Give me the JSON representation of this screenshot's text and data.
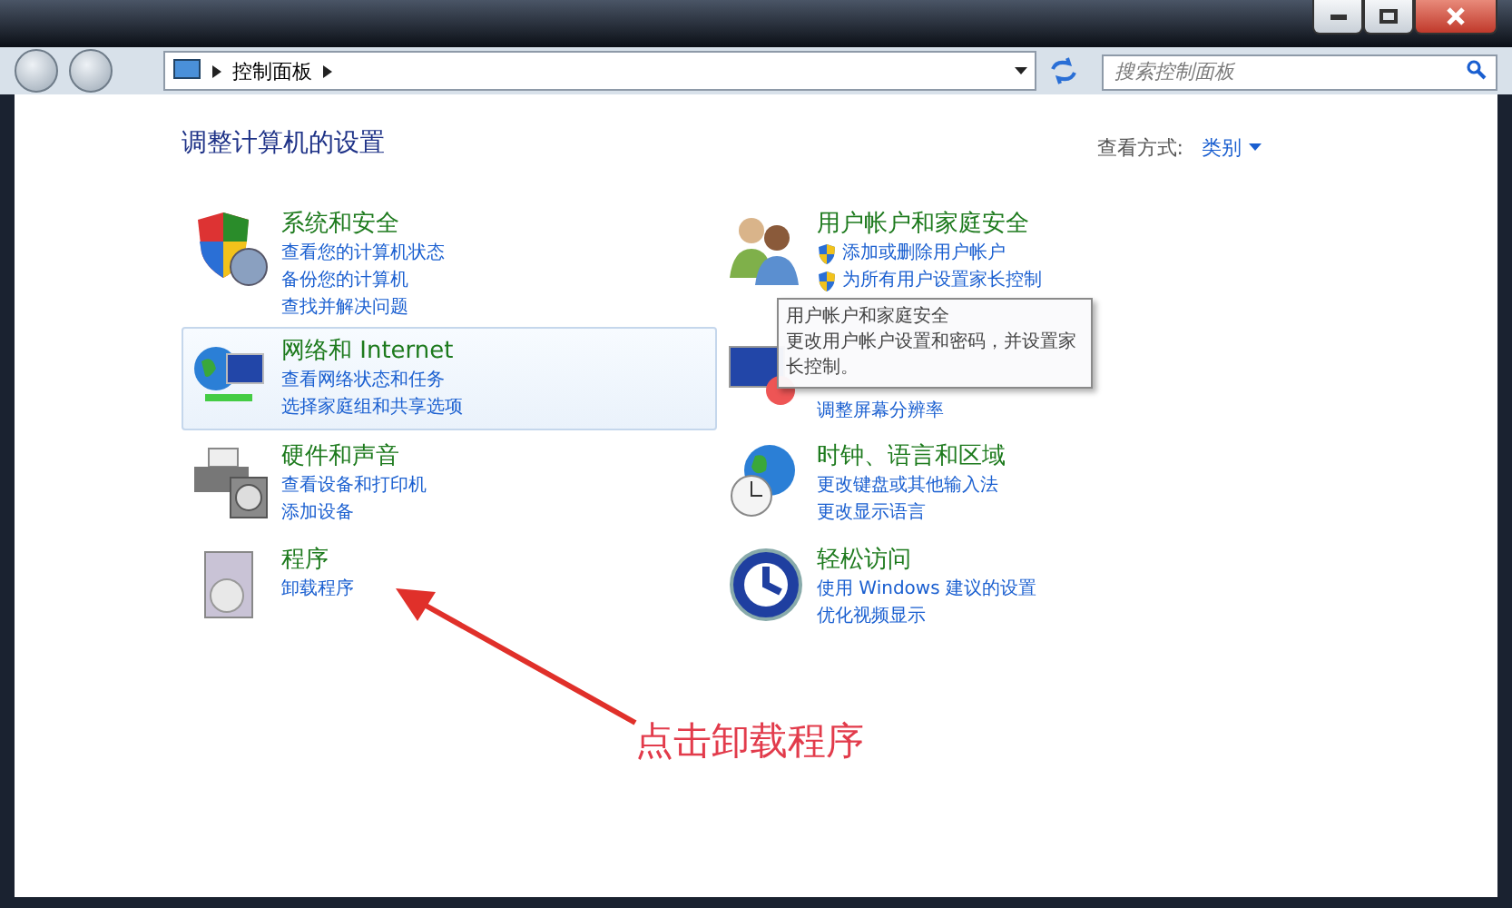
{
  "address_bar": {
    "breadcrumb": [
      "控制面板"
    ]
  },
  "search": {
    "placeholder": "搜索控制面板"
  },
  "header": {
    "title": "调整计算机的设置",
    "view_label": "查看方式:",
    "view_value": "类别"
  },
  "columns": [
    {
      "categories": [
        {
          "kind": "security",
          "title": "系统和安全",
          "highlighted": false,
          "links": [
            {
              "label": "查看您的计算机状态",
              "shield": false
            },
            {
              "label": "备份您的计算机",
              "shield": false
            },
            {
              "label": "查找并解决问题",
              "shield": false
            }
          ]
        },
        {
          "kind": "network",
          "title": "网络和 Internet",
          "highlighted": true,
          "links": [
            {
              "label": "查看网络状态和任务",
              "shield": false
            },
            {
              "label": "选择家庭组和共享选项",
              "shield": false
            }
          ]
        },
        {
          "kind": "hardware",
          "title": "硬件和声音",
          "highlighted": false,
          "links": [
            {
              "label": "查看设备和打印机",
              "shield": false
            },
            {
              "label": "添加设备",
              "shield": false
            }
          ]
        },
        {
          "kind": "programs",
          "title": "程序",
          "highlighted": false,
          "links": [
            {
              "label": "卸载程序",
              "shield": false
            }
          ]
        }
      ]
    },
    {
      "categories": [
        {
          "kind": "users",
          "title": "用户帐户和家庭安全",
          "highlighted": false,
          "links": [
            {
              "label": "添加或删除用户帐户",
              "shield": true
            },
            {
              "label": "为所有用户设置家长控制",
              "shield": true
            }
          ]
        },
        {
          "kind": "appearance",
          "highlighted": false,
          "links": [
            {
              "label": "调整屏幕分辨率",
              "shield": false
            }
          ]
        },
        {
          "kind": "clock",
          "title": "时钟、语言和区域",
          "highlighted": false,
          "links": [
            {
              "label": "更改键盘或其他输入法",
              "shield": false
            },
            {
              "label": "更改显示语言",
              "shield": false
            }
          ]
        },
        {
          "kind": "access",
          "title": "轻松访问",
          "highlighted": false,
          "links": [
            {
              "label": "使用 Windows 建议的设置",
              "shield": false
            },
            {
              "label": "优化视频显示",
              "shield": false
            }
          ]
        }
      ]
    }
  ],
  "tooltip": {
    "title": "用户帐户和家庭安全",
    "text": "更改用户帐户设置和密码，并设置家长控制。"
  },
  "annotation": {
    "text": "点击卸载程序"
  }
}
